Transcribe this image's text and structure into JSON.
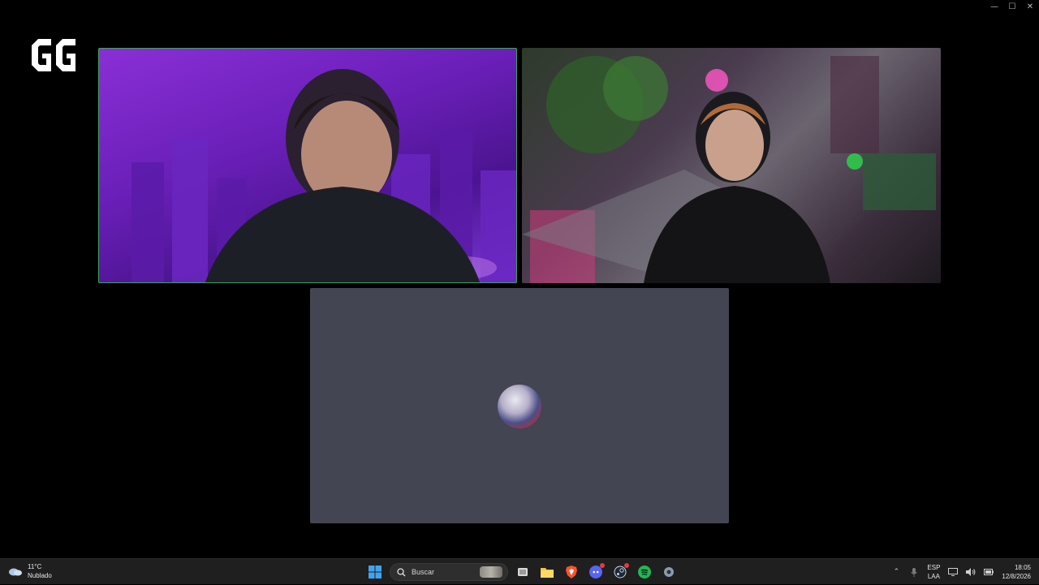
{
  "window_controls": {
    "minimize": "—",
    "maximize": "☐",
    "close": "✕"
  },
  "logo": {
    "text": "GG"
  },
  "tiles": [
    {
      "name": "participant-1",
      "speaking": true,
      "accent": "#3ba55c"
    },
    {
      "name": "participant-2",
      "speaking": false
    },
    {
      "name": "participant-3",
      "speaking": false,
      "camera": "off"
    }
  ],
  "taskbar": {
    "weather": {
      "temp": "11°C",
      "condition": "Nublado"
    },
    "search": {
      "placeholder": "Buscar"
    },
    "apps": [
      "windows-start",
      "search",
      "task-view",
      "file-explorer",
      "brave-browser",
      "discord",
      "steam",
      "spotify",
      "settings"
    ],
    "tray": {
      "lang_top": "ESP",
      "lang_bottom": "LAA",
      "time": "18:05",
      "date": "12/8/2026"
    }
  },
  "colors": {
    "background": "#000000",
    "tile_empty": "#434552",
    "taskbar": "#1f1f1f"
  }
}
